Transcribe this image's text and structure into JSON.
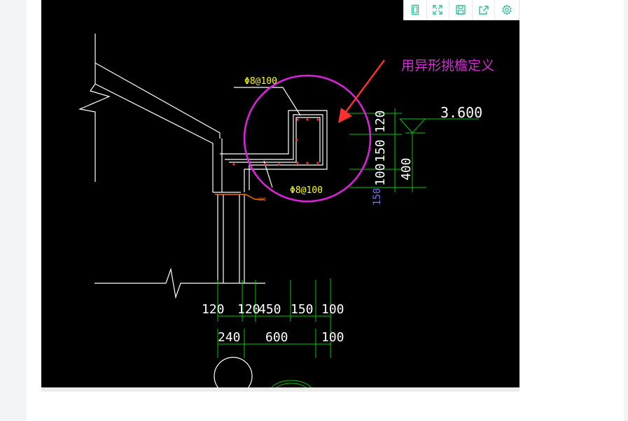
{
  "toolbar": {
    "buttons": [
      {
        "name": "fit-page-icon"
      },
      {
        "name": "fullscreen-icon"
      },
      {
        "name": "save-icon"
      },
      {
        "name": "share-icon"
      },
      {
        "name": "settings-icon"
      }
    ],
    "icon_color": "#2fbf9a"
  },
  "drawing": {
    "annotation": "用异形挑檐定义",
    "rebar_top": "Φ8@100",
    "rebar_bottom": "Φ8@100",
    "elevation": "3.600",
    "vertical_dims": [
      "120",
      "150",
      "100",
      "400",
      "150"
    ],
    "horizontal_dims_row1": [
      "120",
      "120",
      "450",
      "150",
      "100"
    ],
    "horizontal_dims_row2": [
      "240",
      "600",
      "100"
    ],
    "small_label": "228",
    "colors": {
      "background": "#000000",
      "outline": "#ffffff",
      "dimension": "#00c800",
      "rebar_label": "#ffff00",
      "highlight_circle": "#e020e0",
      "arrow": "#ff3030",
      "annotation": "#d22cd2",
      "secondary_dim": "#7070ff"
    }
  }
}
